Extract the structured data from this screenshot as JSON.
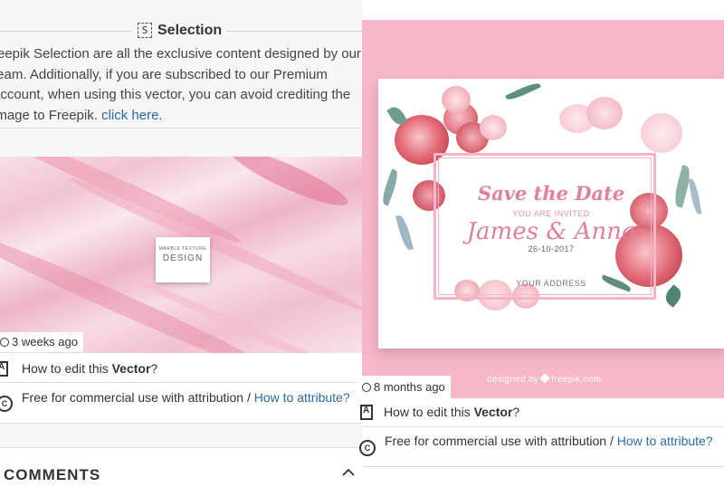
{
  "selection": {
    "badge": "S",
    "title": "Selection",
    "text_prefix": "reepik Selection are all the exclusive content designed by our team. Additionally, if you are subscribed to our Premium account, when using this vector, you can avoid crediting the image to Freepik.",
    "link": "click here",
    "text_suffix": "."
  },
  "left_item": {
    "marble_card_line1": "MARBLE TEXTURE",
    "marble_card_line2": "DESIGN",
    "time_ago": "3 weeks ago",
    "edit_prefix": "How to edit this",
    "edit_type": "Vector",
    "edit_suffix": "?",
    "license_text": "Free for commercial use with attribution /",
    "license_link": "How to attribute?"
  },
  "comments": {
    "title": "COMMENTS"
  },
  "right_item": {
    "card": {
      "save": "Save the Date",
      "invited": "YOU ARE INVITED",
      "names": "James & Anna",
      "date": "26-10-2017",
      "address": "YOUR ADDRESS"
    },
    "designed_by": "designed by",
    "brand": "freepik.com",
    "time_ago": "8 months ago",
    "edit_prefix": "How to edit this",
    "edit_type": "Vector",
    "edit_suffix": "?",
    "license_text": "Free for commercial use with attribution /",
    "license_link": "How to attribute?"
  },
  "colors": {
    "link": "#2a6aa8",
    "pink_background": "#f6b7c8",
    "accent_pink": "#e0809a"
  },
  "icons": {
    "clock": "clock-icon",
    "edit": "edit-document-icon",
    "license": "creative-commons-icon",
    "collapse": "chevron-up-icon"
  }
}
